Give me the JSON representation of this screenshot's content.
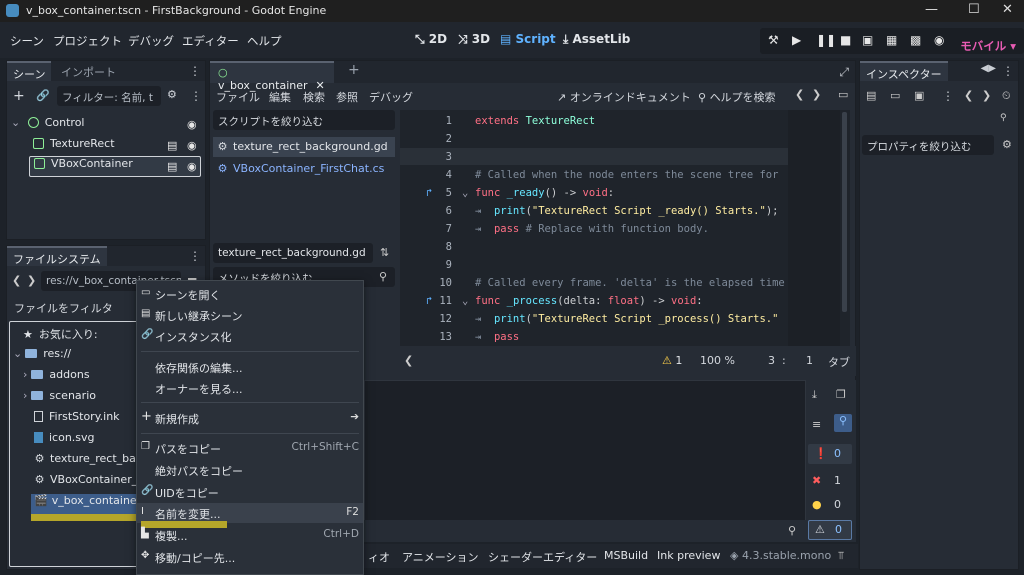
{
  "window": {
    "title": "v_box_container.tscn - FirstBackground - Godot Engine",
    "minimize": "—",
    "maximize": "☐",
    "close": "✕"
  },
  "menus": [
    "シーン",
    "プロジェクト",
    "デバッグ",
    "エディター",
    "ヘルプ"
  ],
  "workspaces": [
    "2D",
    "3D",
    "Script",
    "AssetLib"
  ],
  "active_workspace": "Script",
  "renderer": "モバイル",
  "scene_dock": {
    "tabs": [
      "シーン",
      "インポート"
    ],
    "filter_placeholder": "フィルター: 名前, t",
    "nodes": [
      {
        "name": "Control",
        "type": "root"
      },
      {
        "name": "TextureRect"
      },
      {
        "name": "VBoxContainer"
      }
    ]
  },
  "filesystem": {
    "tab": "ファイルシステム",
    "path": "res://v_box_container.tscn",
    "filter_placeholder": "ファイルをフィルタ",
    "favorites": "お気に入り:",
    "root": "res://",
    "items": [
      "addons",
      "scenario",
      "FirstStory.ink",
      "icon.svg",
      "texture_rect_background.gd",
      "VBoxContainer_FirstChat.cs",
      "v_box_container.tscn"
    ]
  },
  "script_panel": {
    "tab": "v_box_container",
    "menus": [
      "ファイル",
      "編集",
      "検索",
      "参照",
      "デバッグ"
    ],
    "online_docs": "オンラインドキュメント",
    "help_search": "ヘルプを検索",
    "filter_scripts": "スクリプトを絞り込む",
    "scripts": [
      "texture_rect_background.gd",
      "VBoxContainer_FirstChat.cs"
    ],
    "current_script": "texture_rect_background.gd",
    "filter_methods": "メソッドを絞り込む"
  },
  "code": {
    "lines": [
      {
        "n": "1",
        "text": "extends TextureRect"
      },
      {
        "n": "2",
        "text": ""
      },
      {
        "n": "3",
        "text": ""
      },
      {
        "n": "4",
        "text": "# Called when the node enters the scene tree for"
      },
      {
        "n": "5",
        "text": "func _ready() -> void:"
      },
      {
        "n": "6",
        "text": "print(\"TextureRect Script _ready() Starts.\");"
      },
      {
        "n": "7",
        "text": "pass # Replace with function body."
      },
      {
        "n": "8",
        "text": ""
      },
      {
        "n": "9",
        "text": ""
      },
      {
        "n": "10",
        "text": "# Called every frame. 'delta' is the elapsed time"
      },
      {
        "n": "11",
        "text": "func _process(delta: float) -> void:"
      },
      {
        "n": "12",
        "text": "print(\"TextureRect Script _process() Starts.\""
      },
      {
        "n": "13",
        "text": "pass"
      }
    ],
    "status": {
      "warnings": "1",
      "zoom": "100 %",
      "line": "3",
      "sep": ":",
      "col": "1",
      "tabs": "タブ"
    }
  },
  "inspector": {
    "tab": "インスペクター",
    "filter_placeholder": "プロパティを絞り込む"
  },
  "output": {
    "errors": "0",
    "warnings": "1",
    "infos": "0",
    "count": "0",
    "sel_count": "0"
  },
  "context_menu": [
    {
      "label": "シーンを開く",
      "icon": "folder-open-icon"
    },
    {
      "label": "新しい継承シーン",
      "icon": "scene-icon"
    },
    {
      "label": "インスタンス化",
      "icon": "link-icon"
    },
    {
      "sep": true
    },
    {
      "label": "依存関係の編集..."
    },
    {
      "label": "オーナーを見る..."
    },
    {
      "sep": true
    },
    {
      "label": "新規作成",
      "icon": "plus-icon",
      "submenu": true
    },
    {
      "sep": true
    },
    {
      "label": "パスをコピー",
      "icon": "copy-icon",
      "shortcut": "Ctrl+Shift+C"
    },
    {
      "label": "絶対パスをコピー"
    },
    {
      "label": "UIDをコピー",
      "icon": "link-icon"
    },
    {
      "label": "名前を変更...",
      "icon": "rename-icon",
      "shortcut": "F2",
      "highlight": true
    },
    {
      "label": "複製...",
      "icon": "duplicate-icon",
      "shortcut": "Ctrl+D"
    },
    {
      "label": "移動/コピー先...",
      "icon": "move-icon"
    }
  ],
  "bottom_tabs": [
    "ィオ",
    "アニメーション",
    "シェーダーエディター",
    "MSBuild",
    "Ink preview"
  ],
  "version": "4.3.stable.mono"
}
